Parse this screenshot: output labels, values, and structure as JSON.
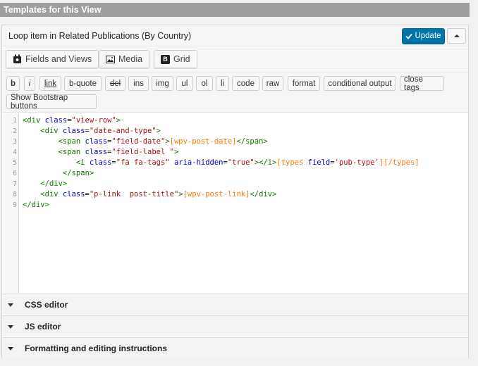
{
  "section_title": "Templates for this View",
  "panel": {
    "title": "Loop item in Related Publications (By Country)",
    "update_label": "Update",
    "collapse_icon": "triangle-up-icon"
  },
  "toolbar": {
    "fields_views_label": "Fields and Views",
    "media_label": "Media",
    "grid_label": "Grid",
    "grid_icon_letter": "B"
  },
  "quicktags": {
    "b": "b",
    "i": "i",
    "link": "link",
    "bquote": "b-quote",
    "del": "del",
    "ins": "ins",
    "img": "img",
    "ul": "ul",
    "ol": "ol",
    "li": "li",
    "code": "code",
    "raw": "raw",
    "format": "format",
    "conditional": "conditional output",
    "close_tags": "close tags",
    "show_bootstrap": "Show Bootstrap buttons"
  },
  "editor": {
    "line_numbers": [
      "1",
      "2",
      "3",
      "4",
      "5",
      "6",
      "7",
      "8",
      "9"
    ],
    "l1": {
      "open": "<div ",
      "attr": "class",
      "eq": "=",
      "val": "\"view-row\"",
      "close": ">"
    },
    "l2": {
      "indent": "    ",
      "open": "<div ",
      "attr": "class",
      "eq": "=",
      "val": "\"date-and-type\"",
      "close": ">"
    },
    "l3": {
      "indent": "        ",
      "open": "<span ",
      "attr": "class",
      "eq": "=",
      "val": "\"field-date\"",
      "close": ">",
      "sc": "[wpv-post-date]",
      "end": "</span>"
    },
    "l4": {
      "indent": "        ",
      "open": "<span ",
      "attr": "class",
      "eq": "=",
      "val": "\"field-label \"",
      "close": ">"
    },
    "l5": {
      "indent": "            ",
      "open": "<i ",
      "attr1": "class",
      "eq1": "=",
      "val1": "\"fa fa-tags\"",
      "sp": " ",
      "attr2": "aria-hidden",
      "eq2": "=",
      "val2": "\"true\"",
      "close": "></i>",
      "sc1": "[types ",
      "scattr": "field",
      "sceq": "=",
      "scval": "'pub-type'",
      "sc2": "][/types]"
    },
    "l6": {
      "indent": "         ",
      "end": "</span>"
    },
    "l7": {
      "indent": "    ",
      "end": "</div>"
    },
    "l8": {
      "indent": "    ",
      "open": "<div ",
      "attr": "class",
      "eq": "=",
      "val": "\"p-link  post-title\"",
      "close": ">",
      "sc": "[wpv-post-link]",
      "end": "</div>"
    },
    "l9": {
      "end": "</div>"
    }
  },
  "accordions": {
    "css": "CSS editor",
    "js": "JS editor",
    "formatting": "Formatting and editing instructions"
  },
  "colors": {
    "accent": "#0073aa",
    "section_bar": "#9e9e9e",
    "tag": "#117700",
    "attribute": "#0000cc",
    "string": "#aa1111",
    "shortcode": "#ff7800"
  }
}
